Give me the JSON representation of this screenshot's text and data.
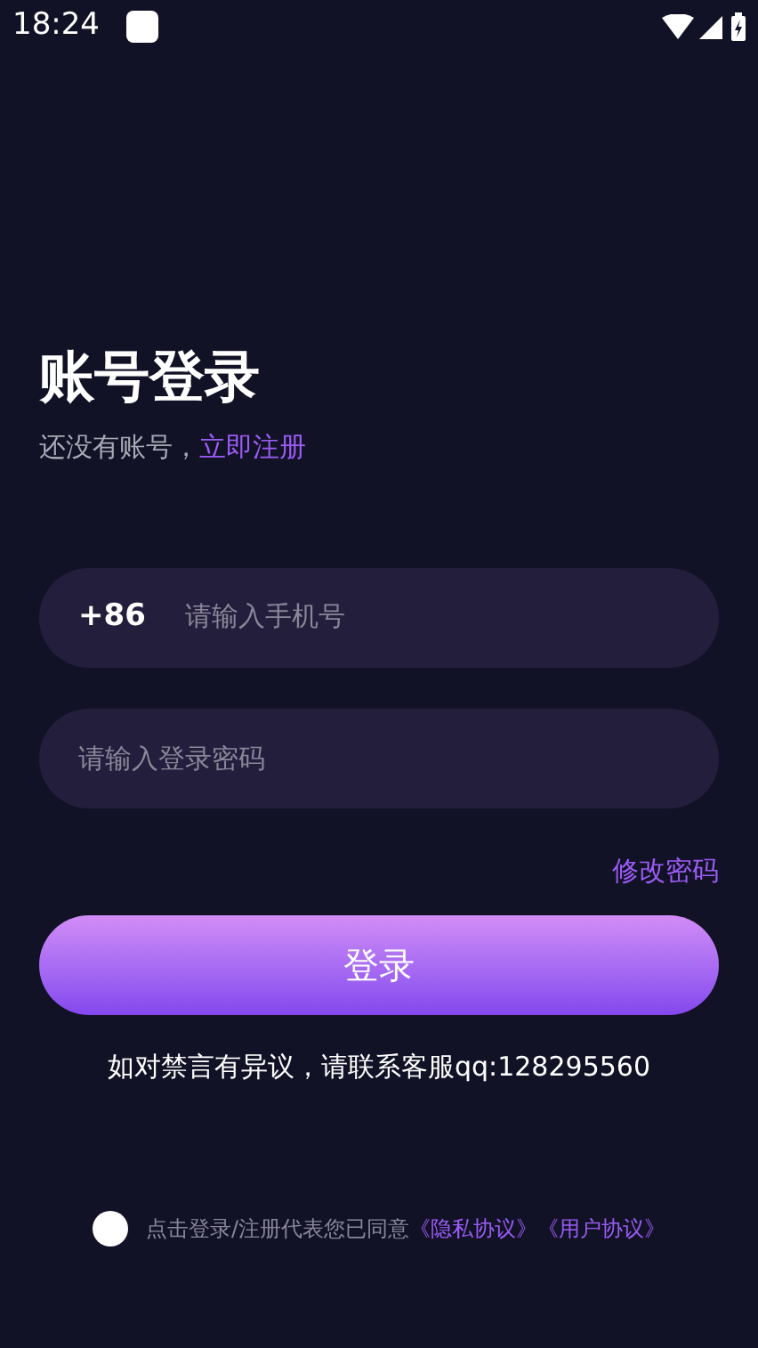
{
  "status_bar": {
    "time": "18:24"
  },
  "title": "账号登录",
  "subtitle": {
    "text": "还没有账号，",
    "link": "立即注册"
  },
  "phone_field": {
    "prefix": "+86",
    "placeholder": "请输入手机号"
  },
  "password_field": {
    "placeholder": "请输入登录密码"
  },
  "forgot_link": "修改密码",
  "login_button": "登录",
  "notice": "如对禁言有异议，请联系客服qq:128295560",
  "agreement": {
    "checked": false,
    "text": "点击登录/注册代表您已同意",
    "links": [
      "《隐私协议》",
      "《用户协议》"
    ]
  }
}
